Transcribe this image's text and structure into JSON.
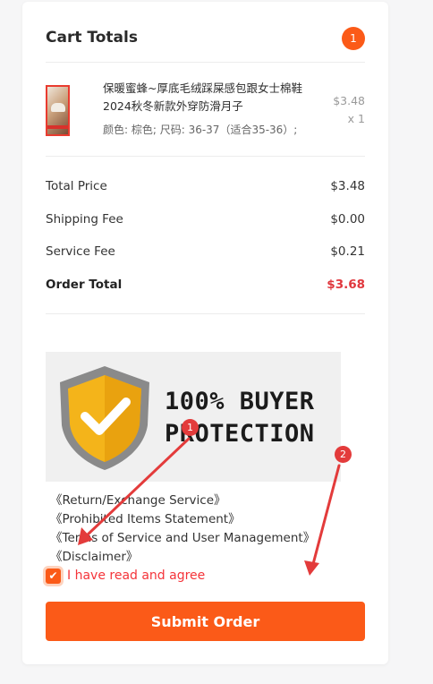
{
  "cart": {
    "title": "Cart Totals",
    "count": "1",
    "item": {
      "name": "保暖蜜蜂~厚底毛绒踩屎感包跟女士棉鞋2024秋冬新款外穿防滑月子",
      "attrs": "颜色: 棕色; 尺码: 36-37（适合35-36）;",
      "price": "$3.48",
      "qty": "x 1"
    }
  },
  "summary": {
    "total_price_label": "Total Price",
    "total_price": "$3.48",
    "shipping_label": "Shipping Fee",
    "shipping": "$0.00",
    "service_label": "Service Fee",
    "service": "$0.21",
    "order_total_label": "Order Total",
    "order_total": "$3.68"
  },
  "banner": {
    "line1": "100% BUYER",
    "line2": "PROTECTION"
  },
  "links": [
    "《Return/Exchange Service》",
    "《Prohibited Items Statement》",
    "《Terms of Service and User Management》",
    "《Disclaimer》"
  ],
  "agree": {
    "checked": true,
    "label": "I have read and agree"
  },
  "submit_label": "Submit Order",
  "annotations": {
    "marker1": "1",
    "marker2": "2"
  },
  "colors": {
    "accent": "#fb5a18",
    "total": "#e0373d",
    "annotation": "#e33b3b"
  }
}
